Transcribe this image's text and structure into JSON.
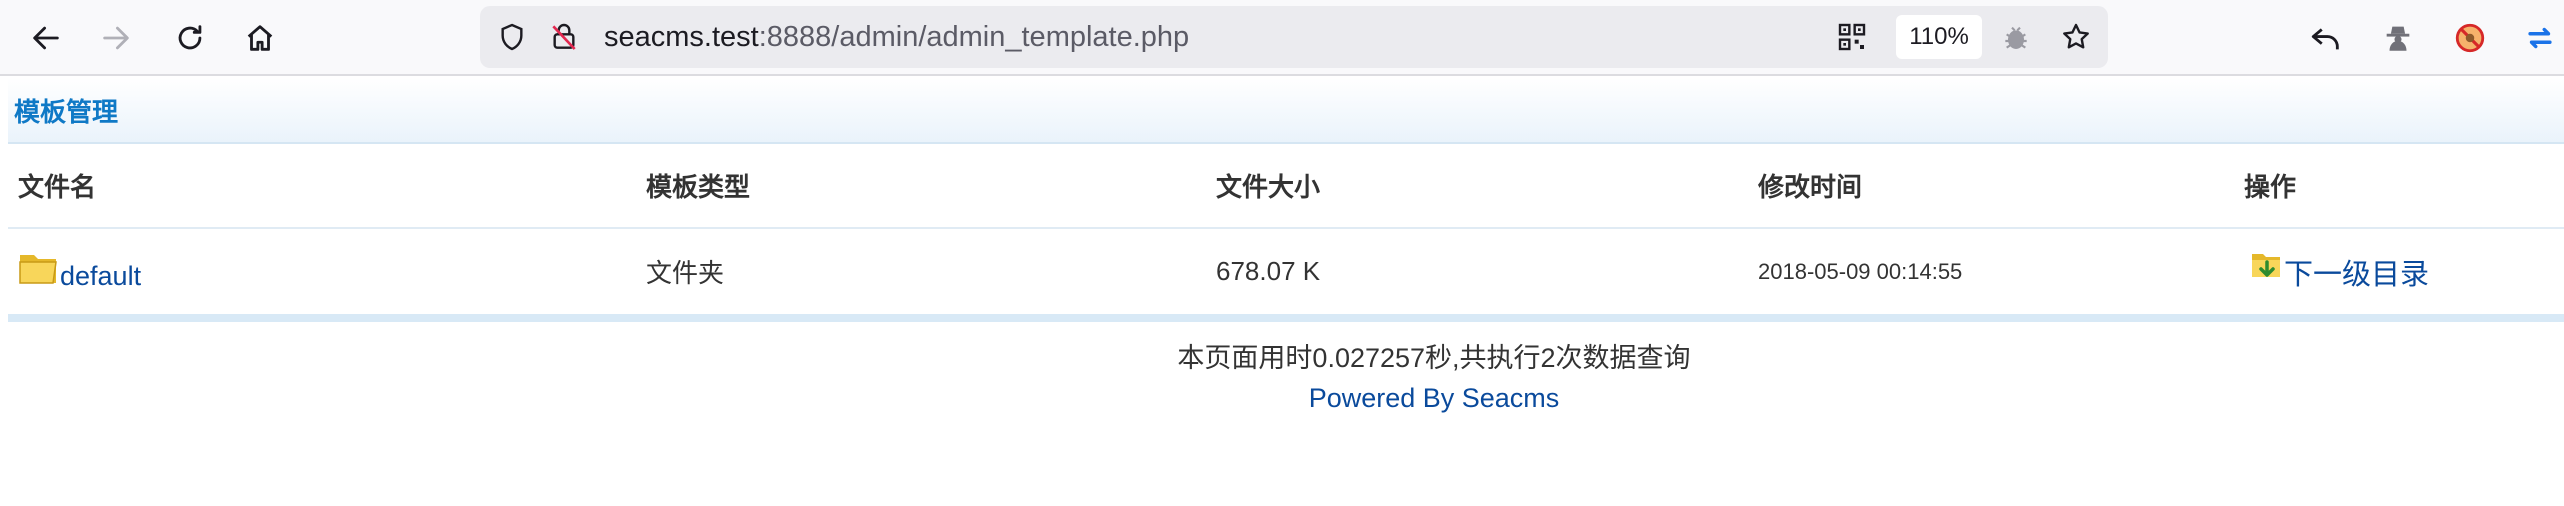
{
  "browser": {
    "url_host": "seacms.test",
    "url_rest": ":8888/admin/admin_template.php",
    "zoom": "110%"
  },
  "page": {
    "title": "模板管理",
    "table": {
      "headers": [
        "文件名",
        "模板类型",
        "文件大小",
        "修改时间",
        "操作"
      ],
      "rows": [
        {
          "name": "default",
          "type": "文件夹",
          "size": "678.07 K",
          "modified": "2018-05-09 00:14:55",
          "action": "下一级目录"
        }
      ]
    },
    "footer": {
      "stats": "本页面用时0.027257秒,共执行2次数据查询",
      "powered": "Powered By Seacms"
    }
  },
  "colors": {
    "title": "#0f79c6",
    "link": "#0a4a9c",
    "accent_blue": "#1b73e8"
  }
}
